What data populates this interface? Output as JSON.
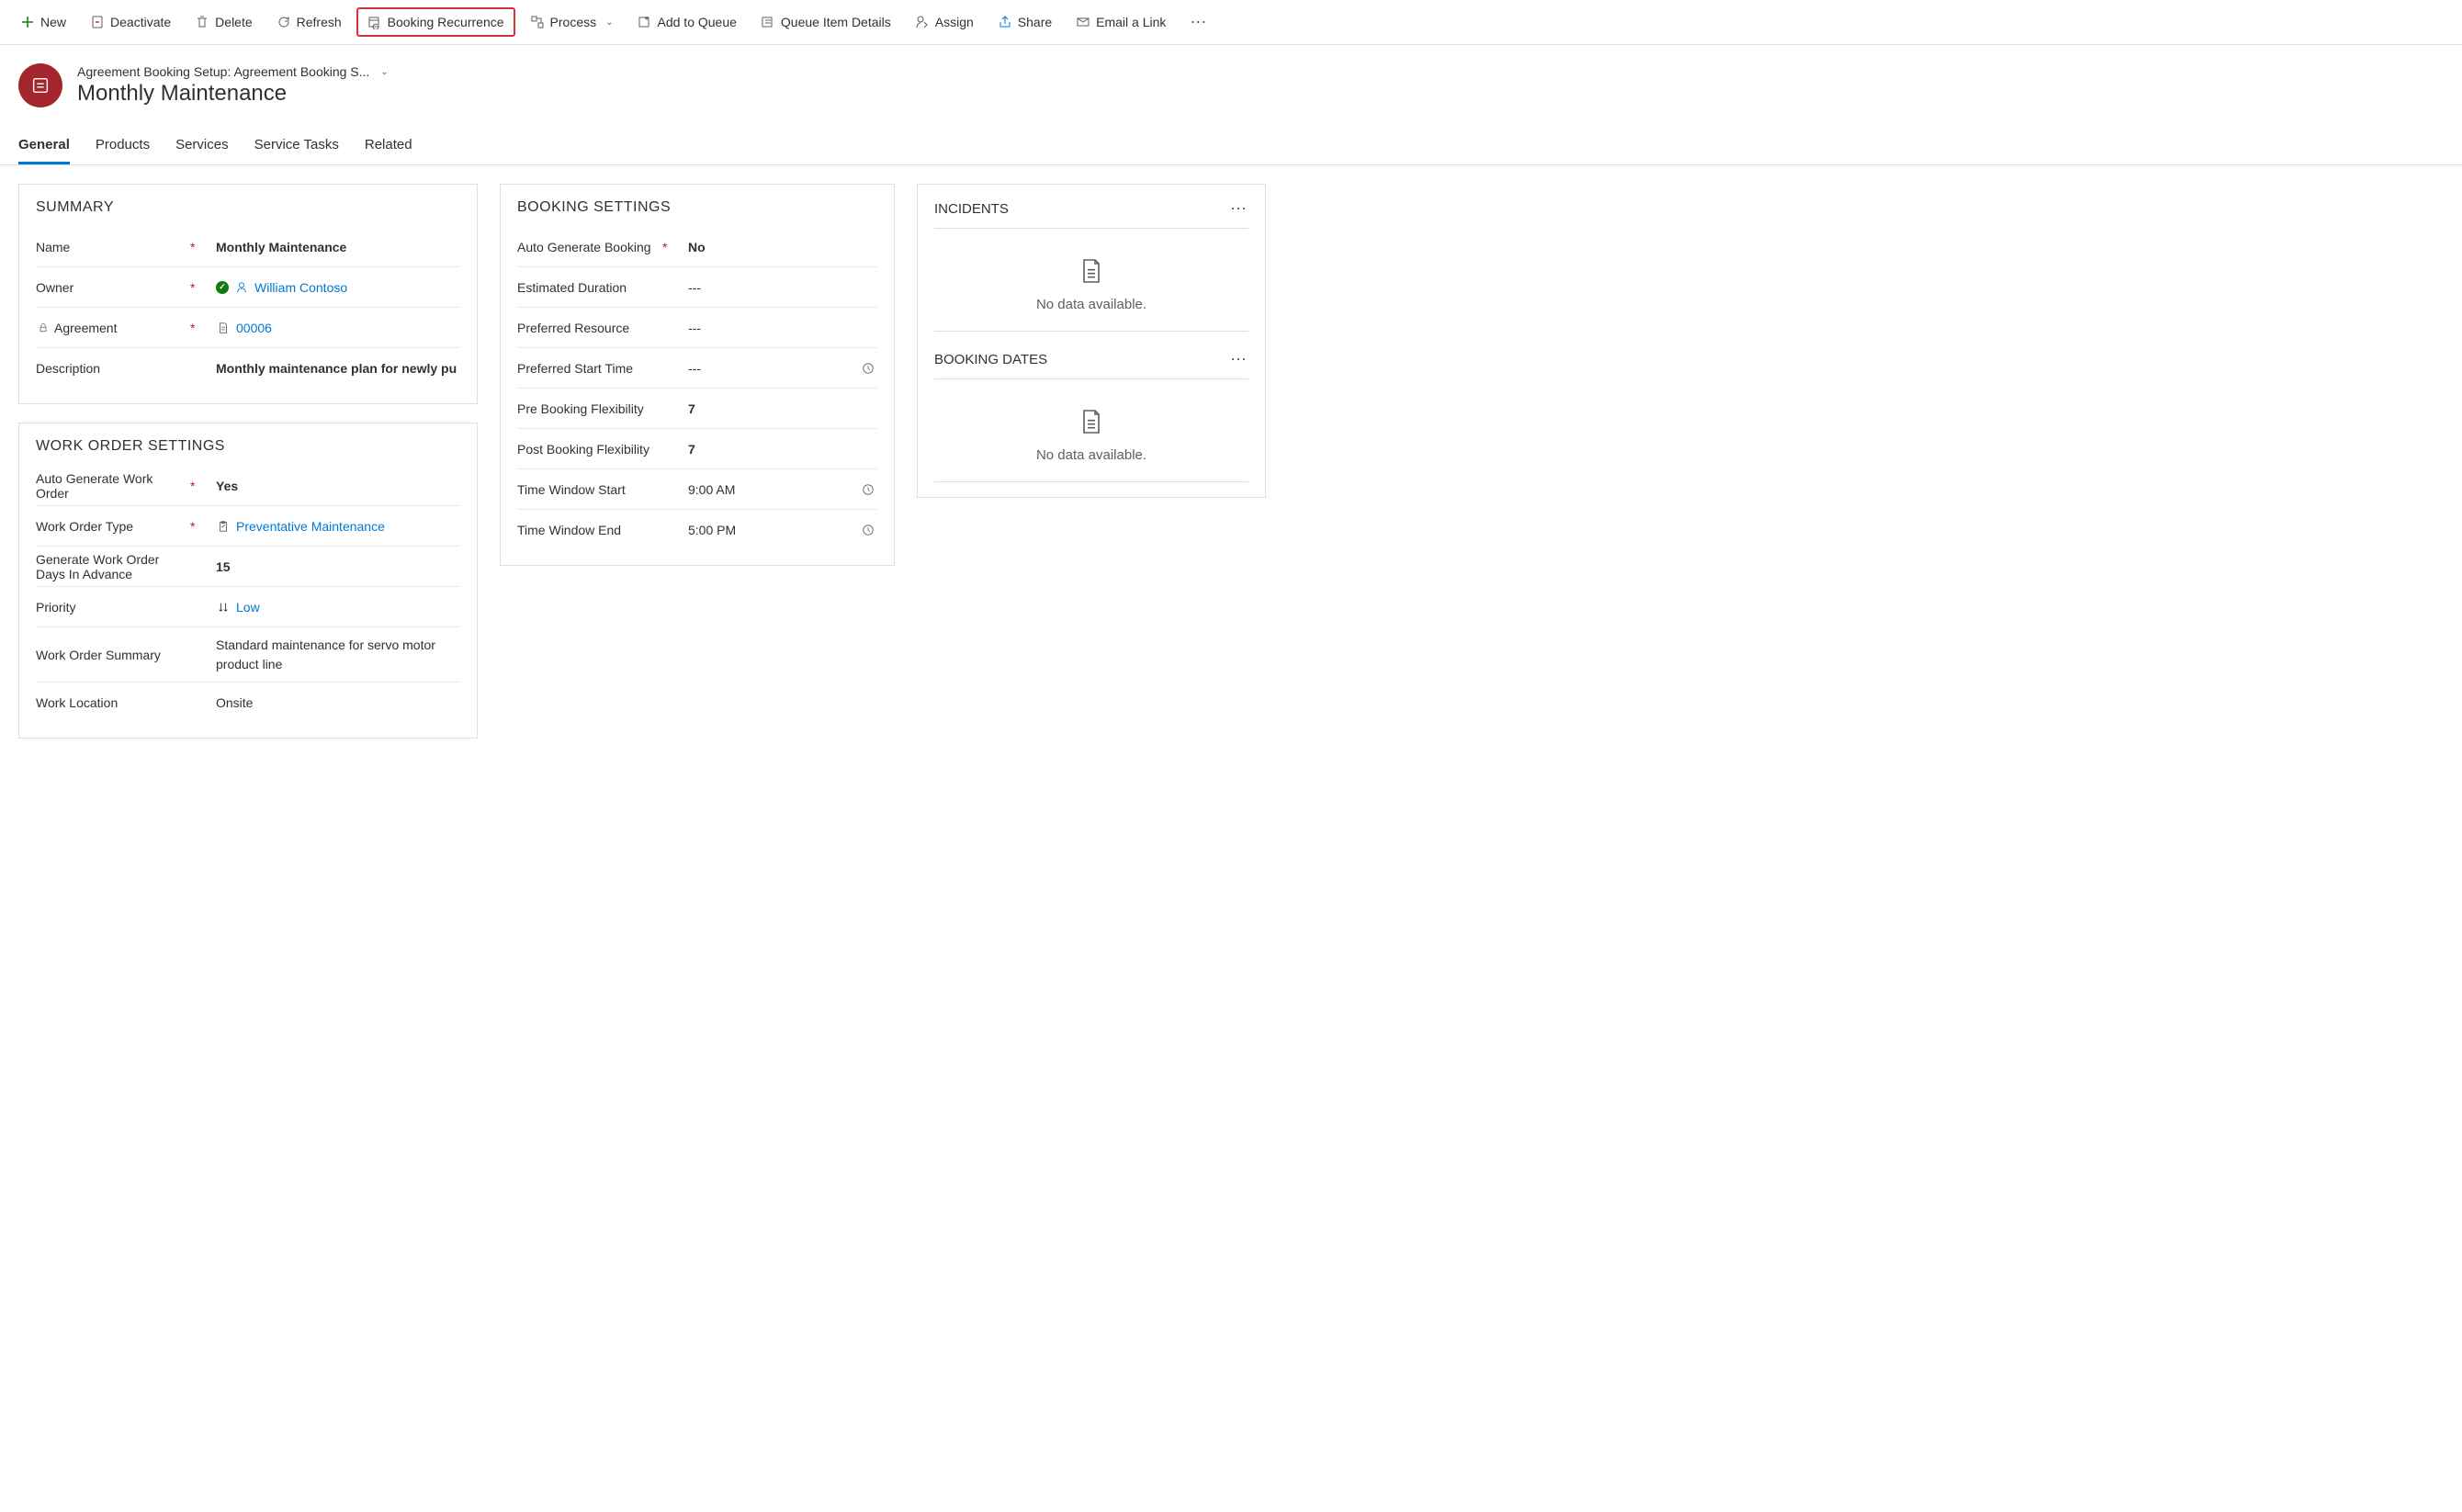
{
  "toolbar": {
    "new": "New",
    "deactivate": "Deactivate",
    "delete": "Delete",
    "refresh": "Refresh",
    "booking_recurrence": "Booking Recurrence",
    "process": "Process",
    "add_to_queue": "Add to Queue",
    "queue_item_details": "Queue Item Details",
    "assign": "Assign",
    "share": "Share",
    "email_link": "Email a Link"
  },
  "header": {
    "breadcrumb": "Agreement Booking Setup: Agreement Booking S...",
    "title": "Monthly Maintenance"
  },
  "tabs": {
    "general": "General",
    "products": "Products",
    "services": "Services",
    "service_tasks": "Service Tasks",
    "related": "Related"
  },
  "summary": {
    "title": "SUMMARY",
    "name_label": "Name",
    "name_value": "Monthly Maintenance",
    "owner_label": "Owner",
    "owner_value": "William Contoso",
    "agreement_label": "Agreement",
    "agreement_value": "00006",
    "description_label": "Description",
    "description_value": "Monthly maintenance plan for newly pu"
  },
  "work_order": {
    "title": "WORK ORDER SETTINGS",
    "auto_gen_label": "Auto Generate Work Order",
    "auto_gen_value": "Yes",
    "type_label": "Work Order Type",
    "type_value": "Preventative Maintenance",
    "days_advance_label": "Generate Work Order Days In Advance",
    "days_advance_value": "15",
    "priority_label": "Priority",
    "priority_value": "Low",
    "summary_label": "Work Order Summary",
    "summary_value": "Standard maintenance for servo motor product line",
    "location_label": "Work Location",
    "location_value": "Onsite"
  },
  "booking": {
    "title": "BOOKING SETTINGS",
    "auto_gen_label": "Auto Generate Booking",
    "auto_gen_value": "No",
    "est_duration_label": "Estimated Duration",
    "est_duration_value": "---",
    "pref_resource_label": "Preferred Resource",
    "pref_resource_value": "---",
    "pref_start_label": "Preferred Start Time",
    "pref_start_value": "---",
    "pre_flex_label": "Pre Booking Flexibility",
    "pre_flex_value": "7",
    "post_flex_label": "Post Booking Flexibility",
    "post_flex_value": "7",
    "window_start_label": "Time Window Start",
    "window_start_value": "9:00 AM",
    "window_end_label": "Time Window End",
    "window_end_value": "5:00 PM"
  },
  "side": {
    "incidents_title": "INCIDENTS",
    "booking_dates_title": "BOOKING DATES",
    "no_data": "No data available."
  }
}
